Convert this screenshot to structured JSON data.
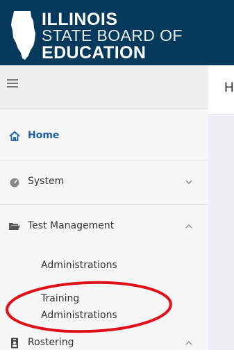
{
  "header": {
    "logo_line1": "ILLINOIS",
    "logo_line2": "STATE BOARD OF",
    "logo_line3": "EDUCATION"
  },
  "main": {
    "title_partial": "H"
  },
  "sidebar": {
    "menu_toggle_icon": "hamburger-icon",
    "items": [
      {
        "label": "Home",
        "icon": "home-icon",
        "active": true
      },
      {
        "label": "System",
        "icon": "gauge-icon",
        "chevron": "chevron-down-icon"
      },
      {
        "label": "Test Management",
        "icon": "folder-open-icon",
        "chevron": "chevron-up-icon",
        "children": [
          {
            "label": "Administrations"
          },
          {
            "label": "Training Administrations"
          }
        ]
      },
      {
        "label": "Rostering",
        "icon": "id-badge-icon",
        "chevron": "chevron-up-icon"
      }
    ]
  },
  "colors": {
    "header_bg": "#063a5c",
    "active_link": "#1f5fa8",
    "annotation_red": "#e0101b"
  }
}
